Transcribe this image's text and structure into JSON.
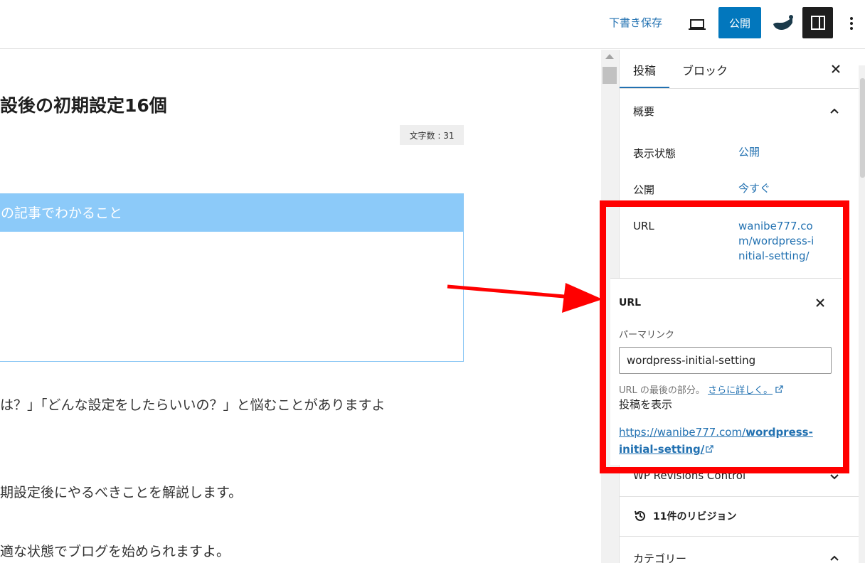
{
  "toolbar": {
    "save_draft": "下書き保存",
    "publish": "公開",
    "icons": [
      "laptop-preview-icon",
      "brand-icon",
      "sidebar-toggle-icon",
      "more-vertical-icon"
    ]
  },
  "editor": {
    "title_fragment": "設後の初期設定16個",
    "word_count": "文字数 : 31",
    "box_heading": "の記事でわかること",
    "paragraphs": [
      "は？」「どんな設定をしたらいいの？」と悩むことがありますよ",
      "期設定後にやるべきことを解説します。",
      "適な状態でブログを始められますよ。"
    ]
  },
  "sidebar": {
    "tabs": [
      "投稿",
      "ブロック"
    ],
    "summary": {
      "title": "概要",
      "visibility_label": "表示状態",
      "visibility_value": "公開",
      "publish_label": "公開",
      "publish_value": "今すぐ",
      "url_label": "URL",
      "url_value": "wanibe777.com/wordpress-initial-setting/"
    },
    "revisions_plugin": "WP Revisions Control",
    "revisions": "11件のリビジョン",
    "category": "カテゴリー"
  },
  "url_popover": {
    "title": "URL",
    "permalink_label": "パーマリンク",
    "slug": "wordpress-initial-setting",
    "help_text": "URL の最後の部分。",
    "help_link": "さらに詳しく。",
    "view_post_label": "投稿を表示",
    "view_link_prefix": "https://wanibe777.com/",
    "view_link_slug": "wordpress-initial-setting/"
  },
  "colors": {
    "accent": "#2271b1",
    "publish_button": "#0277bd",
    "box_header": "#8ccaf9",
    "highlight": "#ff0000"
  }
}
